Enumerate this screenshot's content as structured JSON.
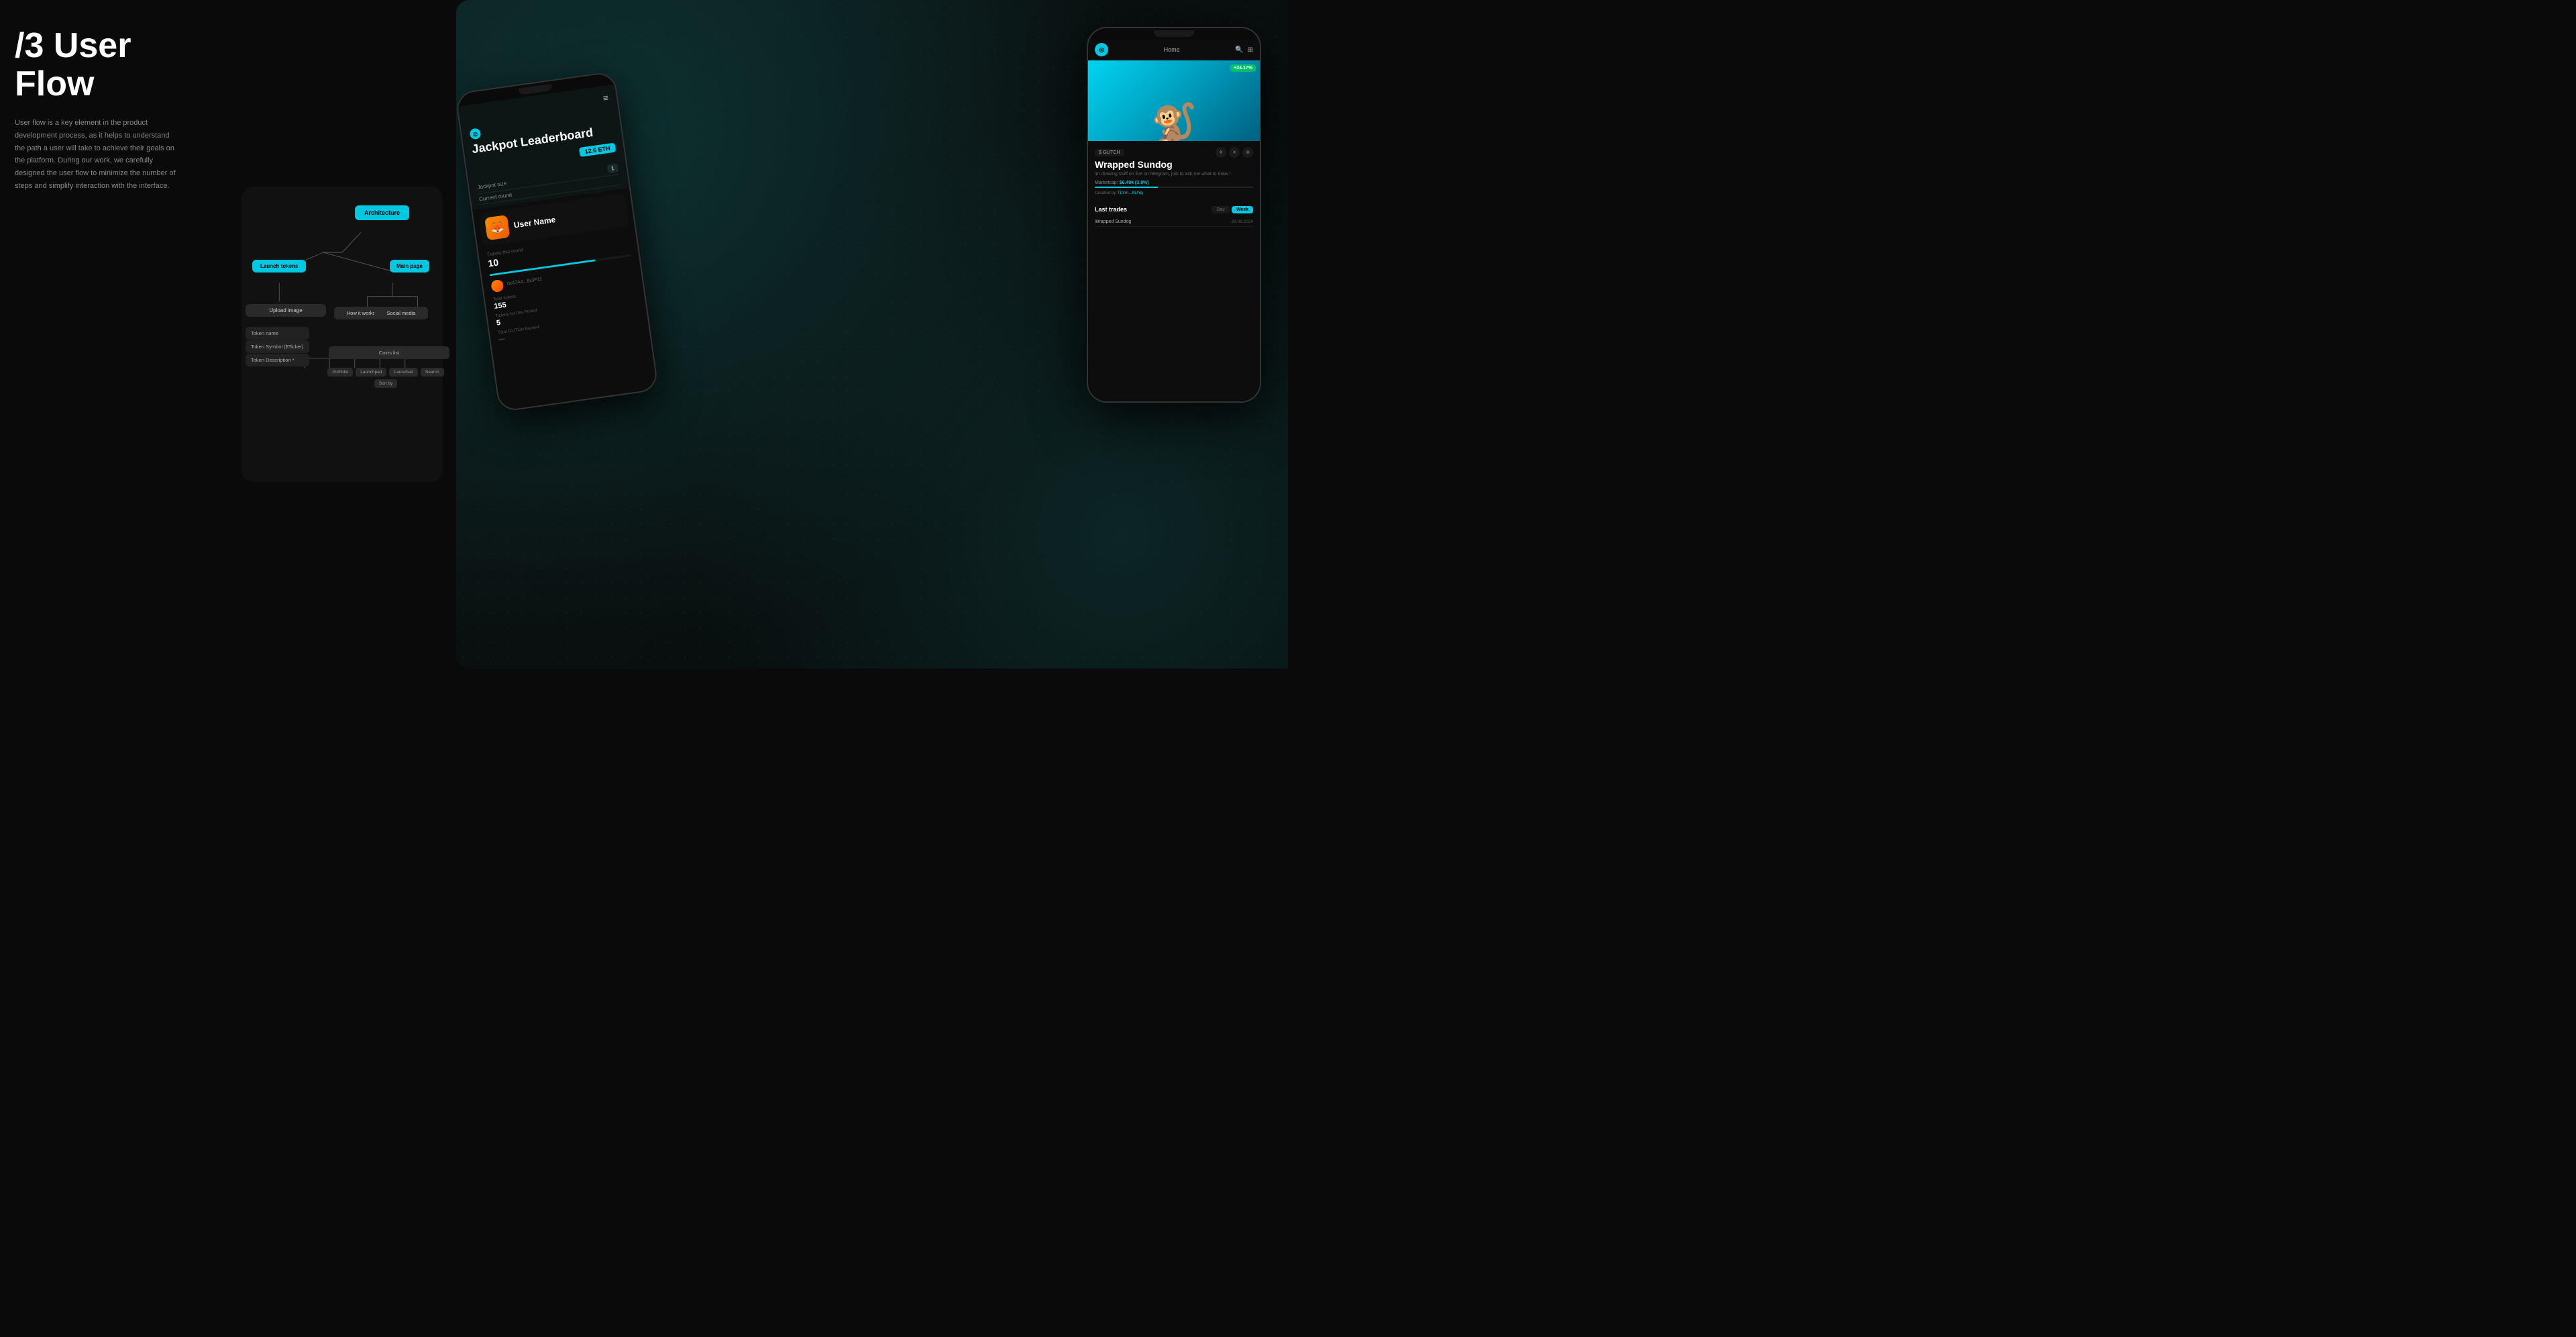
{
  "page": {
    "bg_color": "#0a0a0a"
  },
  "left": {
    "section_label": "/3 User Flow",
    "description": "User flow is a key element in the product development process, as it helps to understand the path a user will take to achieve their goals on the platform. During our work, we carefully designed the user flow to minimize the number of steps and simplify interaction with the interface."
  },
  "flow": {
    "architecture_label": "Architecture",
    "launch_tokens_label": "Launch tokens",
    "main_page_label": "Main page",
    "upload_image_label": "Upload image",
    "token_name_label": "Token name",
    "token_symbol_label": "Token Symbol ($Ticker)",
    "token_description_label": "Token Description *",
    "how_it_works_label": "How it works",
    "social_media_label": "Social media",
    "coins_list_label": "Coins list",
    "portfolio_label": "Portfolio",
    "launchpad_label": "Launchpad",
    "launchad_label": "Launchad",
    "search_label": "Search",
    "sort_by_label": "Sort by"
  },
  "phone_leaderboard": {
    "menu_icon": "≡",
    "title": "Jackpot Leaderboard",
    "eth_amount": "12.6 ETH",
    "jackpot_size_label": "Jackpot size",
    "jackpot_size_val": "1",
    "current_round_label": "Current round",
    "username": "User Name",
    "tickets_this_round_label": "Tickets this round",
    "tickets_count": "10",
    "total_tickets_label": "Total tickets",
    "total_tickets_val": "155",
    "tickets_period_label": "Tickets for this Period",
    "tickets_period_val": "5",
    "addr_label": "0x47A4...8x3F11",
    "total_glitch_label": "Total GLITCH Earned",
    "logo_symbol": "◎"
  },
  "phone_token": {
    "logo_symbol": "◎",
    "nav_home": "Home",
    "menu_icon": "≡",
    "search_placeholder": "Search",
    "nft_percent": "+24.17%",
    "token_tag": "$ GLITCH",
    "token_name": "Wrapped Sundog",
    "token_description": "im drawing stuff on live on telegram, join to ask me what to draw !",
    "marketcap_label": "Marketcap:",
    "marketcap_val": "$6.49k (3.9%)",
    "created_by_label": "Created by",
    "creator_addr": "TLYm...hUYq",
    "last_trades_label": "Last trades",
    "tab_day": "Day",
    "tab_week": "Week",
    "trade_name": "Wrapped Sundog",
    "trade_date": "28.08.2024",
    "filter_icon": "⊞"
  }
}
